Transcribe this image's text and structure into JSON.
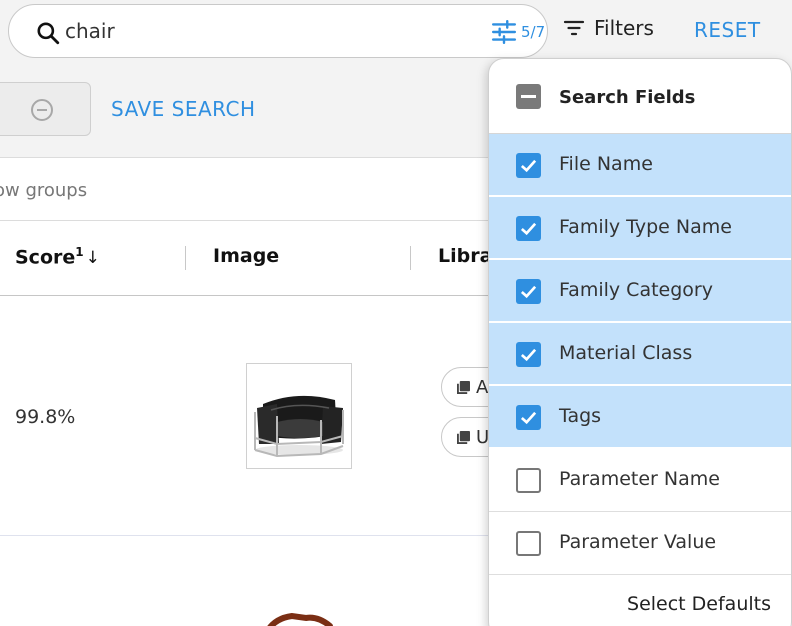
{
  "search": {
    "query": "chair",
    "field_count": "5/7"
  },
  "toolbar": {
    "filters_label": "Filters",
    "reset_label": "RESET",
    "save_search_label": "SAVE SEARCH"
  },
  "grid": {
    "groups_hint": "ow groups",
    "columns": {
      "score": "Score",
      "score_sup": "1",
      "sort_arrow": "↓",
      "image": "Image",
      "library": "Librar"
    },
    "rows": [
      {
        "score": "99.8%",
        "library_chips": [
          "A",
          "U"
        ]
      }
    ]
  },
  "search_fields": {
    "title": "Search Fields",
    "fields": [
      {
        "label": "File Name",
        "checked": true
      },
      {
        "label": "Family Type Name",
        "checked": true
      },
      {
        "label": "Family Category",
        "checked": true
      },
      {
        "label": "Material Class",
        "checked": true
      },
      {
        "label": "Tags",
        "checked": true
      },
      {
        "label": "Parameter Name",
        "checked": false
      },
      {
        "label": "Parameter Value",
        "checked": false
      }
    ],
    "select_defaults_label": "Select Defaults"
  },
  "colors": {
    "accent": "#2f8fe0",
    "selected_row": "#c3e1fb"
  }
}
